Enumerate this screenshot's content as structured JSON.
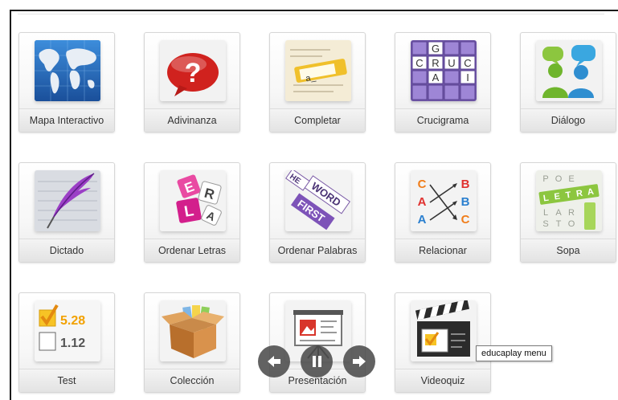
{
  "tiles": [
    {
      "label": "Mapa Interactivo",
      "icon": "world-map-icon"
    },
    {
      "label": "Adivinanza",
      "icon": "question-bubble-icon"
    },
    {
      "label": "Completar",
      "icon": "fill-in-blank-icon"
    },
    {
      "label": "Crucigrama",
      "icon": "crossword-icon"
    },
    {
      "label": "Diálogo",
      "icon": "dialogue-people-icon"
    },
    {
      "label": "Dictado",
      "icon": "quill-pen-icon"
    },
    {
      "label": "Ordenar Letras",
      "icon": "letter-tiles-icon"
    },
    {
      "label": "Ordenar Palabras",
      "icon": "word-tiles-icon"
    },
    {
      "label": "Relacionar",
      "icon": "matching-arrows-icon"
    },
    {
      "label": "Sopa",
      "icon": "word-search-icon"
    },
    {
      "label": "Test",
      "icon": "checklist-icon"
    },
    {
      "label": "Colección",
      "icon": "open-box-icon"
    },
    {
      "label": "Presentación",
      "icon": "presentation-board-icon"
    },
    {
      "label": "Videoquiz",
      "icon": "clapperboard-icon"
    }
  ],
  "icon_text": {
    "completar_blank": "a_",
    "crucigrama": [
      "G",
      "C",
      "R",
      "U",
      "C",
      "A",
      "I"
    ],
    "ordenar_letras": [
      "E",
      "R",
      "L",
      "A"
    ],
    "ordenar_palabras": [
      "WORD",
      "FIRST",
      "HE"
    ],
    "relacionar": [
      "C",
      "A",
      "A",
      "B",
      "B",
      "C"
    ],
    "sopa": [
      "L",
      "E",
      "T",
      "R",
      "A",
      "S",
      "O",
      "P"
    ],
    "test": [
      "5.28",
      "1.12"
    ]
  },
  "player": {
    "controls": [
      "prev-arrow-icon",
      "pause-icon",
      "next-arrow-icon"
    ]
  },
  "tooltip": {
    "text": "educaplay menu"
  }
}
